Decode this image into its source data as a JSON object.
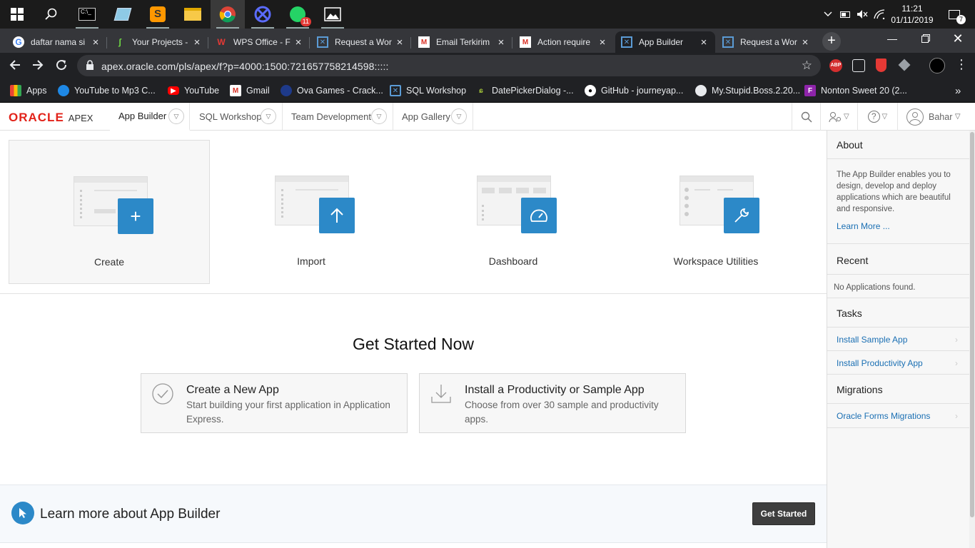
{
  "taskbar": {
    "clock_time": "11:21",
    "clock_date": "01/11/2019",
    "chrome_badge": "11",
    "notification_count": "7",
    "apps": [
      "start-icon",
      "search-icon",
      "cmd-icon",
      "notepad-icon",
      "sublime-icon",
      "file-explorer-icon",
      "chrome-icon",
      "app-icon",
      "whatsapp-icon",
      "photos-icon"
    ]
  },
  "browser": {
    "tabs": [
      {
        "title": "daftar nama si",
        "icon": "google-icon"
      },
      {
        "title": "Your Projects -",
        "icon": "upwork-icon"
      },
      {
        "title": "WPS Office - F",
        "icon": "wps-icon"
      },
      {
        "title": "Request a Wor",
        "icon": "apex-icon"
      },
      {
        "title": "Email Terkirim",
        "icon": "gmail-icon"
      },
      {
        "title": "Action require",
        "icon": "gmail-icon"
      },
      {
        "title": "App Builder",
        "icon": "apex-icon"
      },
      {
        "title": "Request a Wor",
        "icon": "apex-icon"
      }
    ],
    "url": "apex.oracle.com/pls/apex/f?p=4000:1500:721657758214598:::::",
    "bookmarks": [
      {
        "label": "Apps",
        "icon": "apps-grid-icon"
      },
      {
        "label": "YouTube to Mp3 C...",
        "icon": "globe-icon"
      },
      {
        "label": "YouTube",
        "icon": "youtube-icon"
      },
      {
        "label": "Gmail",
        "icon": "gmail-icon"
      },
      {
        "label": "Ova Games - Crack...",
        "icon": "ova-icon"
      },
      {
        "label": "SQL Workshop",
        "icon": "apex-icon"
      },
      {
        "label": "DatePickerDialog -...",
        "icon": "android-icon"
      },
      {
        "label": "GitHub - journeyap...",
        "icon": "github-icon"
      },
      {
        "label": "My.Stupid.Boss.2.20...",
        "icon": "globe-icon"
      },
      {
        "label": "Nonton Sweet 20 (2...",
        "icon": "film-icon"
      }
    ],
    "ext_abp": "ABP"
  },
  "apex": {
    "logo_oracle": "ORACLE",
    "logo_apex": "APEX",
    "nav": [
      "App Builder",
      "SQL Workshop",
      "Team Development",
      "App Gallery"
    ],
    "user": "Bahar",
    "tiles": [
      "Create",
      "Import",
      "Dashboard",
      "Workspace Utilities"
    ],
    "get_started_heading": "Get Started Now",
    "cards": [
      {
        "title": "Create a New App",
        "desc": "Start building your first application in Application Express."
      },
      {
        "title": "Install a Productivity or Sample App",
        "desc": "Choose from over 30 sample and productivity apps."
      }
    ],
    "learn_title": "Learn more about App Builder",
    "learn_button": "Get Started"
  },
  "sidebar": {
    "about_title": "About",
    "about_text": "The App Builder enables you to design, develop and deploy applications which are beautiful and responsive.",
    "learn_more": "Learn More ...",
    "recent_title": "Recent",
    "recent_empty": "No Applications found.",
    "tasks_title": "Tasks",
    "tasks": [
      "Install Sample App",
      "Install Productivity App"
    ],
    "migrations_title": "Migrations",
    "migrations": [
      "Oracle Forms Migrations"
    ]
  },
  "colors": {
    "accent_blue": "#2c89c8",
    "oracle_red": "#e2231a",
    "link_blue": "#1a6fb3"
  }
}
